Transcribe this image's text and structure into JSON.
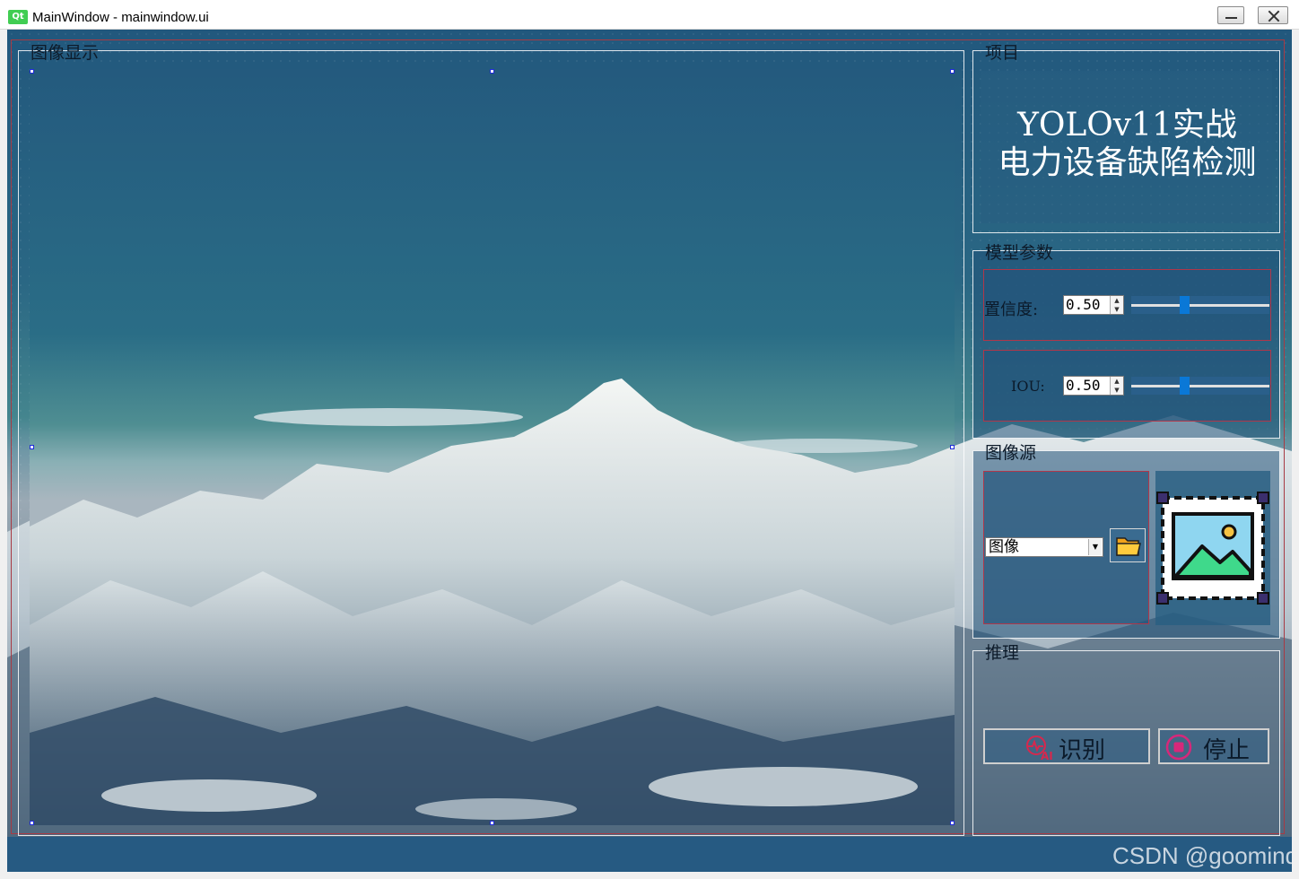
{
  "window": {
    "title": "MainWindow - mainwindow.ui",
    "app_icon": "Qt",
    "controls": [
      "minimize-icon",
      "close-icon"
    ]
  },
  "display": {
    "title": "图像显示"
  },
  "project": {
    "title": "项目",
    "heading_line1": "YOLOv11实战",
    "heading_line2": "电力设备缺陷检测"
  },
  "params": {
    "title": "模型参数",
    "confidence": {
      "label": "置信度:",
      "value": "0.50",
      "slider_fraction": 0.38
    },
    "iou": {
      "label": "IOU:",
      "value": "0.50",
      "slider_fraction": 0.38
    }
  },
  "source": {
    "title": "图像源",
    "selected": "图像",
    "folder_icon": "folder-icon",
    "image_icon": "image-icon"
  },
  "inference": {
    "title": "推理",
    "detect_label": "识别",
    "stop_label": "停止"
  },
  "watermark": "CSDN @goomind",
  "colors": {
    "accent_red": "#b0374a",
    "slider_blue": "#0a78d7",
    "panel_blue": "#265a82"
  }
}
